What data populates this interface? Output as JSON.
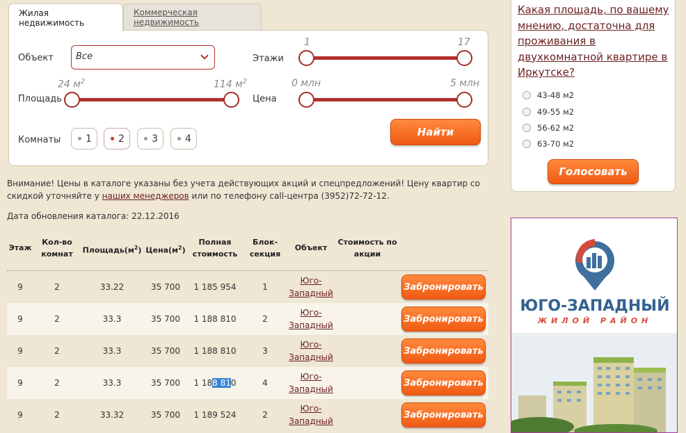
{
  "tabs": {
    "residential": "Жилая недвижимость",
    "commercial": "Коммерческая недвижимость"
  },
  "search": {
    "object_label": "Объект",
    "object_value": "Все",
    "floors_label": "Этажи",
    "floors_min": "1",
    "floors_max": "17",
    "area_label": "Площадь",
    "area_min": "24 м",
    "area_max": "114 м",
    "area_unit_sup": "2",
    "price_label": "Цена",
    "price_min": "0 млн",
    "price_max": "5 млн",
    "rooms_label": "Комнаты",
    "rooms": [
      "1",
      "2",
      "3",
      "4"
    ],
    "selected_room": "2",
    "find_button": "Найти"
  },
  "notice": {
    "part1": "Внимание! Цены в каталоге указаны без учета действующих акций и спецпредложений! Цену квартир со скидкой уточняйте у ",
    "link": "наших менеджеров",
    "part2": " или по телефону call-центра (3952)72-72-12."
  },
  "updated": "Дата обновления каталога: 22.12.2016",
  "table": {
    "headers": {
      "floor": "Этаж",
      "rooms_1": "Кол-во",
      "rooms_2": "комнат",
      "area": "Площадь(м",
      "price": "Цена(м",
      "sup": "2",
      "close": ")",
      "total_1": "Полная",
      "total_2": "стоимость",
      "block_1": "Блок-",
      "block_2": "секция",
      "object": "Объект",
      "promo_1": "Стоимость по",
      "promo_2": "акции"
    },
    "rows": [
      {
        "floor": "9",
        "rooms": "2",
        "area": "33.22",
        "price": "35 700",
        "total": "1 185 954",
        "block": "1",
        "object_1": "Юго-",
        "object_2": "Западный"
      },
      {
        "floor": "9",
        "rooms": "2",
        "area": "33.3",
        "price": "35 700",
        "total": "1 188 810",
        "block": "2",
        "object_1": "Юго-",
        "object_2": "Западный"
      },
      {
        "floor": "9",
        "rooms": "2",
        "area": "33.3",
        "price": "35 700",
        "total": "1 188 810",
        "block": "3",
        "object_1": "Юго-",
        "object_2": "Западный"
      },
      {
        "floor": "9",
        "rooms": "2",
        "area": "33.3",
        "price": "35 700",
        "total_a": "1 18",
        "total_b": "8 81",
        "total_c": "0",
        "block": "4",
        "object_1": "Юго-",
        "object_2": "Западный"
      },
      {
        "floor": "9",
        "rooms": "2",
        "area": "33.32",
        "price": "35 700",
        "total": "1 189 524",
        "block": "2",
        "object_1": "Юго-",
        "object_2": "Западный"
      }
    ],
    "book_button": "Забронировать"
  },
  "poll": {
    "question": "Какая площадь, по вашему мнению, достаточна для проживания в двухкомнатной квартире в Иркутске?",
    "options": [
      "43-48 м2",
      "49-55 м2",
      "56-62 м2",
      "63-70 м2"
    ],
    "vote_button": "Голосовать"
  },
  "ad": {
    "title": "ЮГО-ЗАПАДНЫЙ",
    "subtitle": "ЖИЛОЙ РАЙОН"
  },
  "colors": {
    "accent_red": "#b2312b",
    "button_orange": "#f05a12",
    "link": "#6b1f1f",
    "background": "#efe6d4"
  }
}
